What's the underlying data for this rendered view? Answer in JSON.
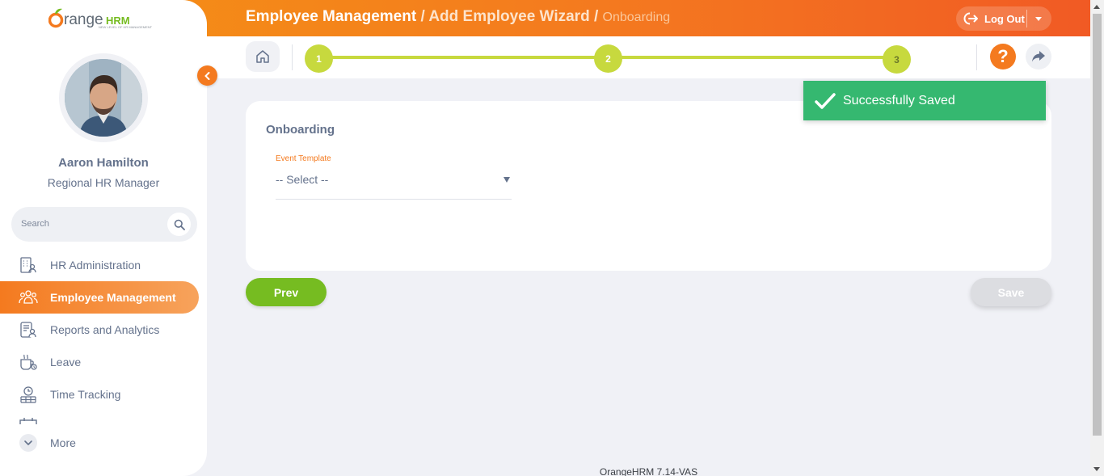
{
  "header": {
    "breadcrumb_main": "Employee Management",
    "breadcrumb_sep": " / ",
    "breadcrumb_mid": "Add Employee Wizard",
    "breadcrumb_current": "Onboarding",
    "logout_label": "Log Out"
  },
  "wizard": {
    "steps": [
      "1",
      "2",
      "3"
    ],
    "current_step": 3
  },
  "sidebar": {
    "logo_text": "OrangeHRM",
    "logo_tagline": "NEW LEVEL OF HR MANAGEMENT",
    "user_name": "Aaron Hamilton",
    "user_role": "Regional HR Manager",
    "search_placeholder": "Search",
    "items": [
      {
        "label": "HR Administration",
        "icon": "building-user-icon",
        "active": false
      },
      {
        "label": "Employee Management",
        "icon": "people-group-icon",
        "active": true
      },
      {
        "label": "Reports and Analytics",
        "icon": "report-user-icon",
        "active": false
      },
      {
        "label": "Leave",
        "icon": "leave-icon",
        "active": false
      },
      {
        "label": "Time Tracking",
        "icon": "time-tracking-icon",
        "active": false
      }
    ],
    "more_label": "More"
  },
  "form": {
    "title": "Onboarding",
    "event_template_label": "Event Template",
    "event_template_value": "-- Select --"
  },
  "buttons": {
    "prev": "Prev",
    "save": "Save"
  },
  "toast": {
    "message": "Successfully Saved"
  },
  "footer": {
    "version": "OrangeHRM 7.14-VAS"
  },
  "colors": {
    "brand_orange": "#f47a1f",
    "step_green": "#c7d93e",
    "prev_green": "#76bc21",
    "toast_green": "#35b870"
  }
}
